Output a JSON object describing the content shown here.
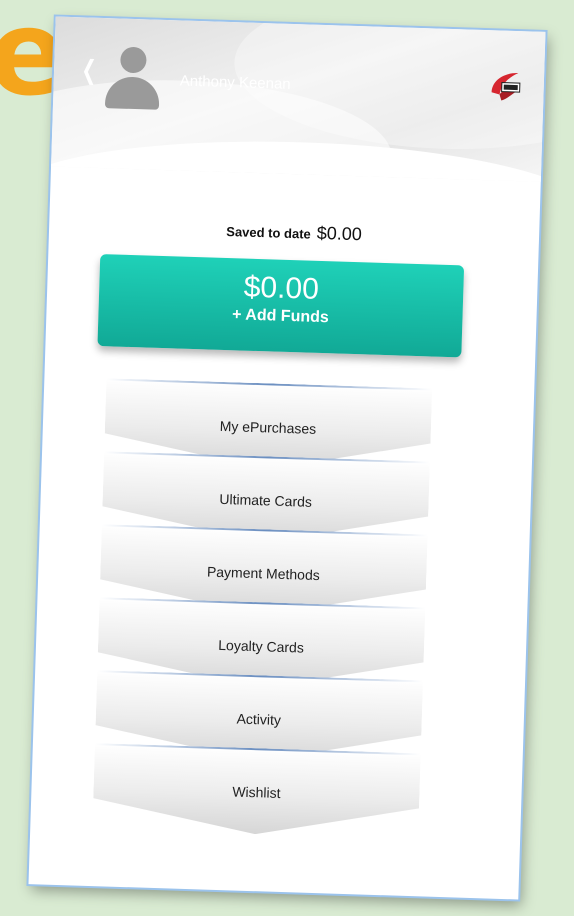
{
  "header": {
    "user_name": "Anthony Keenan",
    "back_icon": "chevron-left-icon",
    "avatar_icon": "user-avatar-icon",
    "logo_icon": "brand-logo-icon"
  },
  "savings": {
    "label": "Saved to date",
    "value": "$0.00"
  },
  "balance": {
    "amount": "$0.00",
    "add_funds_label": "+ Add Funds"
  },
  "menu": {
    "items": [
      {
        "label": "My ePurchases"
      },
      {
        "label": "Ultimate Cards"
      },
      {
        "label": "Payment Methods"
      },
      {
        "label": "Loyalty Cards"
      },
      {
        "label": "Activity"
      },
      {
        "label": "Wishlist"
      }
    ]
  },
  "colors": {
    "accent_teal": "#14b9a4",
    "background_green": "#d9ebd2",
    "letter_orange": "#f4a51c",
    "logo_red": "#d6262f"
  }
}
